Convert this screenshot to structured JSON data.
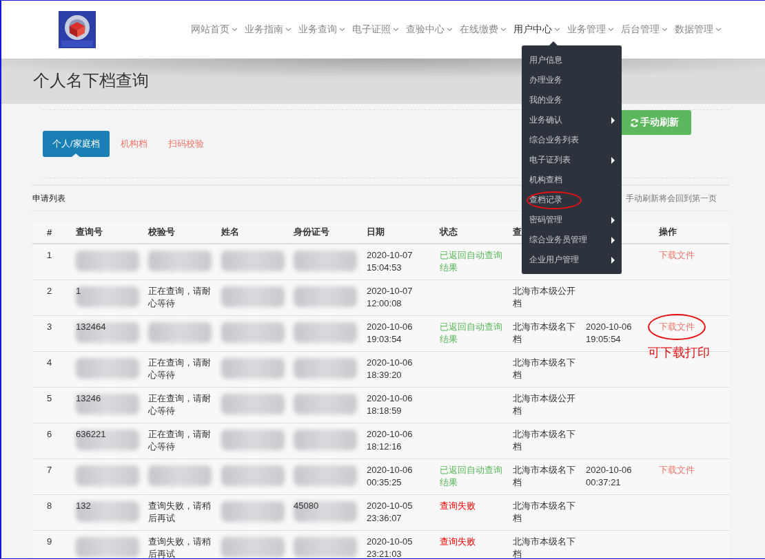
{
  "nav": {
    "items": [
      {
        "label": "网站首页",
        "selected": false
      },
      {
        "label": "业务指南",
        "selected": false
      },
      {
        "label": "业务查询",
        "selected": false
      },
      {
        "label": "电子证照",
        "selected": false
      },
      {
        "label": "查验中心",
        "selected": false
      },
      {
        "label": "在线缴费",
        "selected": false
      },
      {
        "label": "用户中心",
        "selected": true
      },
      {
        "label": "业务管理",
        "selected": false
      },
      {
        "label": "后台管理",
        "selected": false
      },
      {
        "label": "数据管理",
        "selected": false
      }
    ]
  },
  "page_title": "个人名下档查询",
  "tabs": [
    {
      "label": "个人/家庭档",
      "selected": true
    },
    {
      "label": "机构档",
      "selected": false
    },
    {
      "label": "扫码校验",
      "selected": false
    }
  ],
  "refresh_button": "手动刷新",
  "list_title": "申请列表",
  "refresh_note": "手动刷新将会回到第一页",
  "table": {
    "columns": [
      "#",
      "查询号",
      "校验号",
      "姓名",
      "身份证号",
      "日期",
      "状态",
      "查",
      "",
      "操作"
    ],
    "rows": [
      {
        "no": "1",
        "query_no": {
          "blurred": true
        },
        "check_no": {
          "blurred": true
        },
        "name": {
          "blurred": true
        },
        "id_no": {
          "blurred": true
        },
        "date": "2020-10-07 15:04:53",
        "status": {
          "text": "已返回自动查询结果",
          "kind": "returned"
        },
        "action": {
          "text": "下载文件",
          "circled": false
        }
      },
      {
        "no": "2",
        "query_no": {
          "blurred": true,
          "text": "1"
        },
        "check_no": "正在查询，请耐心等待",
        "name": {
          "blurred": true
        },
        "id_no": {
          "blurred": true
        },
        "date": "2020-10-07 12:00:08",
        "type": "北海市本级公开档"
      },
      {
        "no": "3",
        "query_no": {
          "blurred": true,
          "text": "132464"
        },
        "check_no": {
          "blurred": true
        },
        "name": {
          "blurred": true
        },
        "id_no": {
          "blurred": true
        },
        "date": "2020-10-06 19:03:54",
        "status": {
          "text": "已返回自动查询结果",
          "kind": "returned"
        },
        "type": "北海市本级名下档",
        "done": "2020-10-06 19:05:54",
        "action": {
          "text": "下载文件",
          "circled": true
        }
      },
      {
        "no": "4",
        "query_no": {
          "blurred": true
        },
        "check_no": "正在查询，请耐心等待",
        "name": {
          "blurred": true
        },
        "id_no": {
          "blurred": true
        },
        "date": "2020-10-06 18:39:20",
        "type": "北海市本级名下档"
      },
      {
        "no": "5",
        "query_no": {
          "blurred": true,
          "text": "13246"
        },
        "check_no": "正在查询，请耐心等待",
        "name": {
          "blurred": true
        },
        "id_no": {
          "blurred": true
        },
        "date": "2020-10-06 18:18:59",
        "type": "北海市本级公开档"
      },
      {
        "no": "6",
        "query_no": {
          "blurred": true,
          "text": "636221"
        },
        "check_no": "正在查询，请耐心等待",
        "name": {
          "blurred": true
        },
        "id_no": {
          "blurred": true
        },
        "date": "2020-10-06 18:12:16",
        "type": "北海市本级名下档"
      },
      {
        "no": "7",
        "query_no": {
          "blurred": true
        },
        "check_no": {
          "blurred": true
        },
        "name": {
          "blurred": true
        },
        "id_no": {
          "blurred": true
        },
        "date": "2020-10-06 00:35:25",
        "status": {
          "text": "已返回自动查询结果",
          "kind": "returned"
        },
        "type": "北海市本级名下档",
        "done": "2020-10-06 00:37:21",
        "action": {
          "text": "下载文件",
          "circled": false
        }
      },
      {
        "no": "8",
        "query_no": {
          "blurred": true,
          "text": "132"
        },
        "check_no": "查询失败，请稍后再试",
        "name": {
          "blurred": true
        },
        "id_no": {
          "blurred": true,
          "text": "45080"
        },
        "date": "2020-10-05 23:36:07",
        "status": {
          "text": "查询失败",
          "kind": "failed"
        },
        "type": "北海市本级名下档"
      },
      {
        "no": "9",
        "query_no": {
          "blurred": true
        },
        "check_no": "查询失败，请稍后再试",
        "name": {
          "blurred": true
        },
        "id_no": {
          "blurred": true
        },
        "date": "2020-10-05 23:21:03",
        "status": {
          "text": "查询失败",
          "kind": "failed"
        },
        "type": "北海市本级名下档"
      }
    ]
  },
  "user_menu": {
    "items": [
      {
        "label": "用户信息",
        "has_submenu": false,
        "circled": false
      },
      {
        "label": "办理业务",
        "has_submenu": false,
        "circled": false
      },
      {
        "label": "我的业务",
        "has_submenu": false,
        "circled": false
      },
      {
        "label": "业务确认",
        "has_submenu": true,
        "circled": false
      },
      {
        "label": "综合业务列表",
        "has_submenu": false,
        "circled": false
      },
      {
        "label": "电子证列表",
        "has_submenu": true,
        "circled": false
      },
      {
        "label": "机构查档",
        "has_submenu": false,
        "circled": false
      },
      {
        "label": "查档记录",
        "has_submenu": false,
        "circled": true
      },
      {
        "label": "密码管理",
        "has_submenu": true,
        "circled": false
      },
      {
        "label": "综合业务员管理",
        "has_submenu": true,
        "circled": false
      },
      {
        "label": "企业用户管理",
        "has_submenu": true,
        "circled": false
      }
    ]
  },
  "annotation": {
    "text": "可下载打印"
  }
}
